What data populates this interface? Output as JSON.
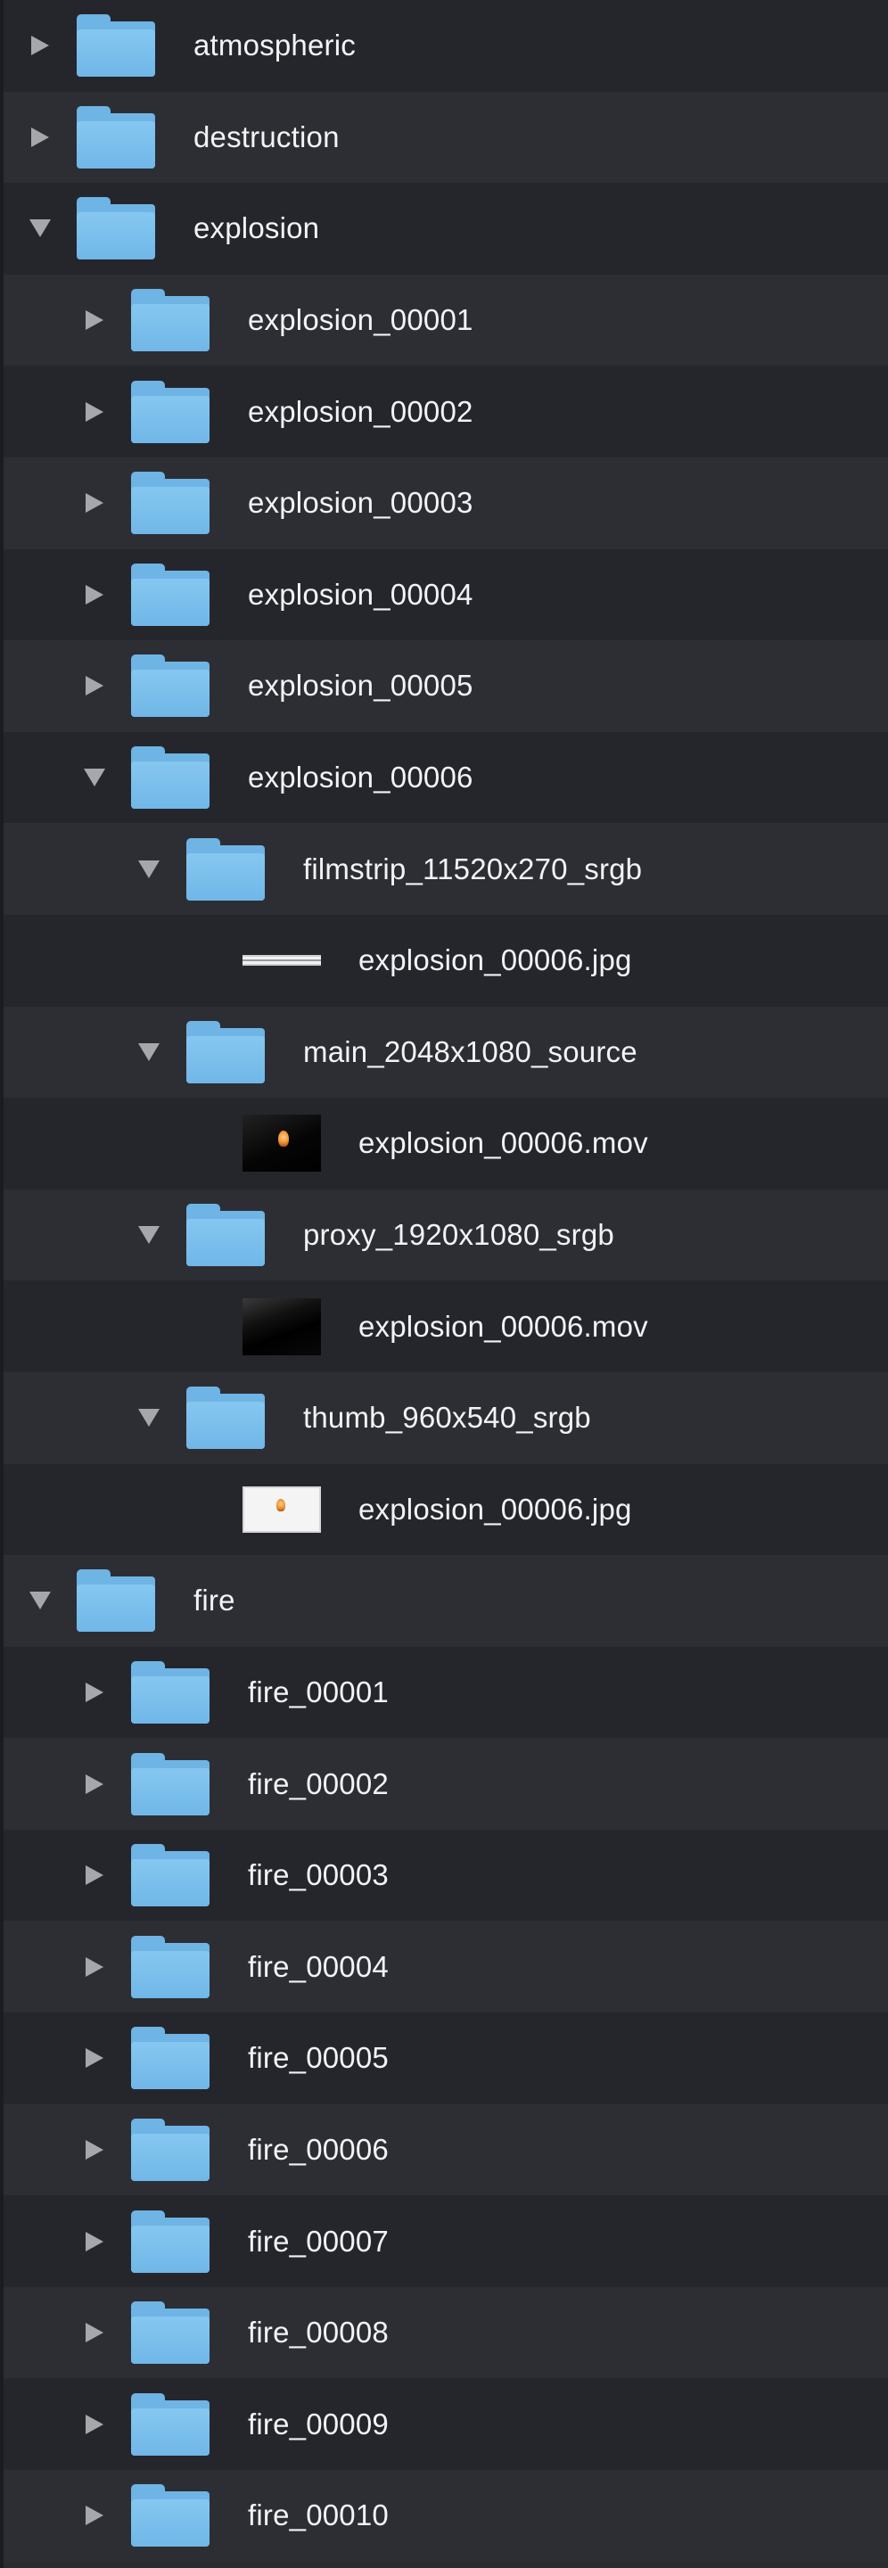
{
  "rows": [
    {
      "label": "atmospheric",
      "icon": "folder-icon",
      "disclosure": "collapsed"
    },
    {
      "label": "destruction",
      "icon": "folder-icon",
      "disclosure": "collapsed"
    },
    {
      "label": "explosion",
      "icon": "folder-icon",
      "disclosure": "expanded"
    },
    {
      "label": "explosion_00001",
      "icon": "folder-icon",
      "disclosure": "collapsed"
    },
    {
      "label": "explosion_00002",
      "icon": "folder-icon",
      "disclosure": "collapsed"
    },
    {
      "label": "explosion_00003",
      "icon": "folder-icon",
      "disclosure": "collapsed"
    },
    {
      "label": "explosion_00004",
      "icon": "folder-icon",
      "disclosure": "collapsed"
    },
    {
      "label": "explosion_00005",
      "icon": "folder-icon",
      "disclosure": "collapsed"
    },
    {
      "label": "explosion_00006",
      "icon": "folder-icon",
      "disclosure": "expanded"
    },
    {
      "label": "filmstrip_11520x270_srgb",
      "icon": "folder-icon",
      "disclosure": "expanded"
    },
    {
      "label": "explosion_00006.jpg",
      "icon": "filmstrip-thumbnail-icon"
    },
    {
      "label": "main_2048x1080_source",
      "icon": "folder-icon",
      "disclosure": "expanded"
    },
    {
      "label": "explosion_00006.mov",
      "icon": "video-thumbnail-icon"
    },
    {
      "label": "proxy_1920x1080_srgb",
      "icon": "folder-icon",
      "disclosure": "expanded"
    },
    {
      "label": "explosion_00006.mov",
      "icon": "dark-video-thumbnail-icon"
    },
    {
      "label": "thumb_960x540_srgb",
      "icon": "folder-icon",
      "disclosure": "expanded"
    },
    {
      "label": "explosion_00006.jpg",
      "icon": "image-thumbnail-icon"
    },
    {
      "label": "fire",
      "icon": "folder-icon",
      "disclosure": "expanded"
    },
    {
      "label": "fire_00001",
      "icon": "folder-icon",
      "disclosure": "collapsed"
    },
    {
      "label": "fire_00002",
      "icon": "folder-icon",
      "disclosure": "collapsed"
    },
    {
      "label": "fire_00003",
      "icon": "folder-icon",
      "disclosure": "collapsed"
    },
    {
      "label": "fire_00004",
      "icon": "folder-icon",
      "disclosure": "collapsed"
    },
    {
      "label": "fire_00005",
      "icon": "folder-icon",
      "disclosure": "collapsed"
    },
    {
      "label": "fire_00006",
      "icon": "folder-icon",
      "disclosure": "collapsed"
    },
    {
      "label": "fire_00007",
      "icon": "folder-icon",
      "disclosure": "collapsed"
    },
    {
      "label": "fire_00008",
      "icon": "folder-icon",
      "disclosure": "collapsed"
    },
    {
      "label": "fire_00009",
      "icon": "folder-icon",
      "disclosure": "collapsed"
    },
    {
      "label": "fire_00010",
      "icon": "folder-icon",
      "disclosure": "collapsed"
    }
  ],
  "colors": {
    "row_odd": "#2c2e34",
    "row_even": "#25262c",
    "folder": "#74bbea",
    "text": "#f2f3f5",
    "disclosure": "#a6a7ab"
  }
}
